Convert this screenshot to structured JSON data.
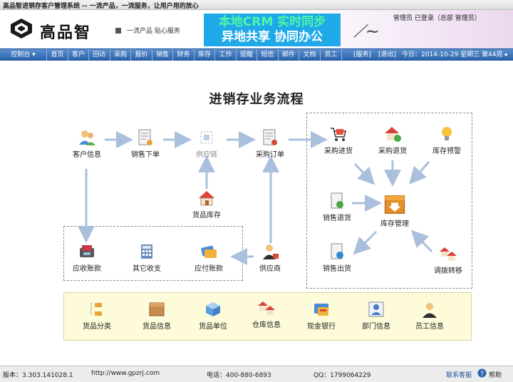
{
  "window": {
    "title": "高品智进销存客户管理系统 -- 一流产品，一流服务，让用户用的放心"
  },
  "header": {
    "brand": "高品智",
    "slogan": "一流产品 贴心服务",
    "banner_line1": "本地CRM 实时同步",
    "banner_line2": "异地共享 协同办公",
    "user_info": "管理员 已登录（总部 管理员）"
  },
  "nav": {
    "items": [
      "控制台 ▾",
      "首页",
      "客户",
      "回访",
      "采购",
      "报价",
      "销售",
      "财务",
      "库存",
      "工作",
      "提醒",
      "短信",
      "邮件",
      "文档",
      "员工"
    ],
    "service": "[服务]",
    "exit": "[退出]",
    "date_info": "今日：2014-10-29 星期三 第44周",
    "scroll_arrow": "◂"
  },
  "flow": {
    "title": "进销存业务流程",
    "nodes": {
      "customer": "客户信息",
      "sales_order": "销售下单",
      "supply_chain": "供应链",
      "purchase_order": "采购订单",
      "goods_stock": "货品库存",
      "supplier": "供应商",
      "receivable": "应收账款",
      "other_income": "其它收支",
      "payable": "应付账款",
      "purchase_in": "采购进货",
      "purchase_return": "采购退货",
      "stock_alert": "库存预警",
      "sales_return": "销售退货",
      "stock_mgmt": "库存管理",
      "sales_out": "销售出货",
      "transfer": "调拨转移"
    }
  },
  "bottom": {
    "items": [
      "货品分类",
      "货品信息",
      "货品单位",
      "仓库信息",
      "现金银行",
      "部门信息",
      "员工信息"
    ]
  },
  "status": {
    "version": "版本：3.303.141028.1",
    "url": "http://www.gpzrj.com",
    "phone": "电话：400-880-6893",
    "qq": "QQ：1799064229",
    "contact": "联系客服",
    "help": "帮助"
  },
  "colors": {
    "nav_bg": "#2b63ad",
    "arrow": "#a9bfdc",
    "banner": "#1fa9e8"
  }
}
